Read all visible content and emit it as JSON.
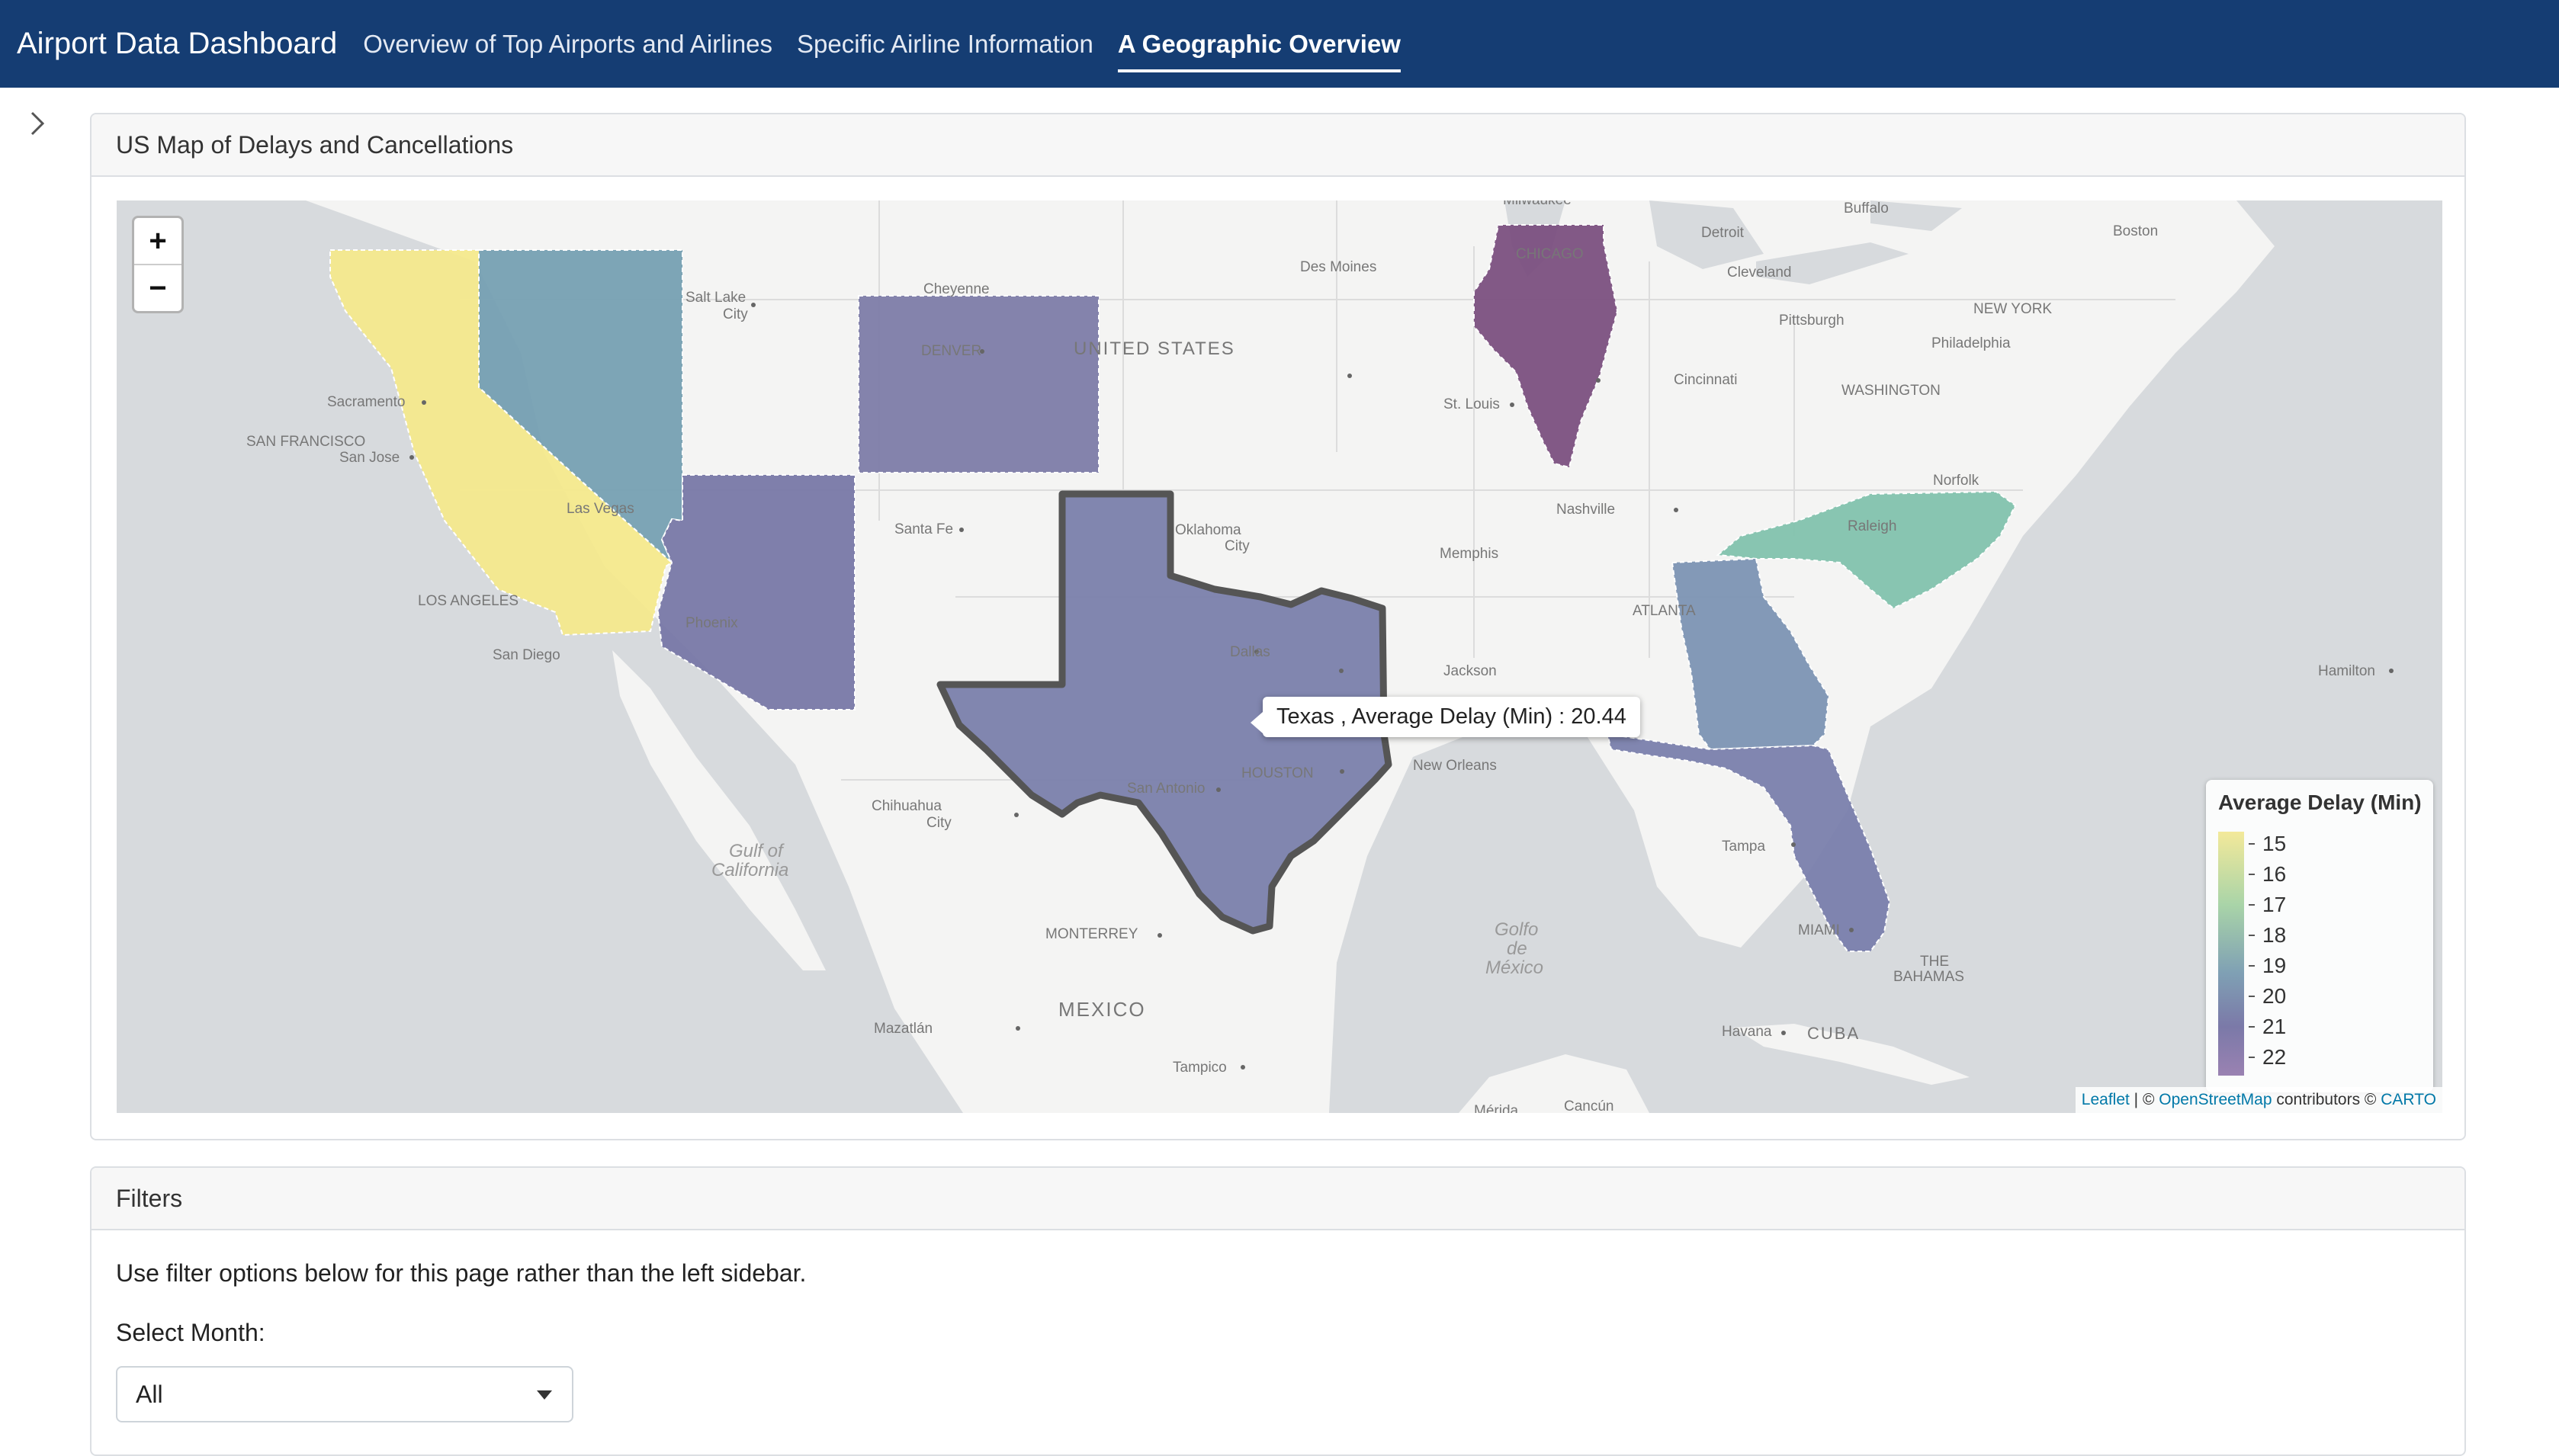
{
  "navbar": {
    "brand": "Airport Data Dashboard",
    "links": [
      {
        "label": "Overview of Top Airports and Airlines"
      },
      {
        "label": "Specific Airline Information"
      },
      {
        "label": "A Geographic Overview",
        "active": true
      }
    ]
  },
  "map_card": {
    "title": "US Map of Delays and Cancellations",
    "zoom_in": "+",
    "zoom_out": "−",
    "tooltip": "Texas , Average Delay (Min) : 20.44",
    "states": [
      {
        "name": "California",
        "color": "#f4e98c"
      },
      {
        "name": "Nevada",
        "color": "#76a0b2"
      },
      {
        "name": "Colorado",
        "color": "#7d7ca8"
      },
      {
        "name": "Arizona",
        "color": "#7878a6"
      },
      {
        "name": "Texas",
        "color": "#7a80ab"
      },
      {
        "name": "Illinois",
        "color": "#7b507f"
      },
      {
        "name": "North Carolina",
        "color": "#82c2ad"
      },
      {
        "name": "Georgia",
        "color": "#7c94b3"
      },
      {
        "name": "Florida",
        "color": "#7a80ac"
      }
    ],
    "legend": {
      "title": "Average Delay (Min)",
      "ticks": [
        "15",
        "16",
        "17",
        "18",
        "19",
        "20",
        "21",
        "22"
      ]
    },
    "map_labels": {
      "milwaukee": "Milwaukee",
      "detroit": "Detroit",
      "buffalo": "Buffalo",
      "boston": "Boston",
      "des_moines": "Des Moines",
      "chicago": "CHICAGO",
      "cleveland": "Cleveland",
      "pittsburgh": "Pittsburgh",
      "new_york": "NEW YORK",
      "philadelphia": "Philadelphia",
      "washington": "WASHINGTON",
      "salt_lake_1": "Salt Lake",
      "salt_lake_2": "City",
      "cheyenne": "Cheyenne",
      "denver": "DENVER",
      "united_states": "UNITED STATES",
      "sacramento": "Sacramento",
      "san_francisco": "SAN FRANCISCO",
      "san_jose": "San Jose",
      "st_louis": "St. Louis",
      "cincinnati": "Cincinnati",
      "nashville": "Nashville",
      "norfolk": "Norfolk",
      "raleigh": "Raleigh",
      "las_vegas": "Las Vegas",
      "santa_fe": "Santa Fe",
      "oklahoma_city_1": "Oklahoma",
      "oklahoma_city_2": "City",
      "memphis": "Memphis",
      "los_angeles": "LOS ANGELES",
      "san_diego": "San Diego",
      "phoenix": "Phoenix",
      "atlanta": "ATLANTA",
      "dallas": "Dallas",
      "jackson": "Jackson",
      "hamilton": "Hamilton",
      "new_orleans": "New Orleans",
      "houston": "HOUSTON",
      "san_antonio": "San Antonio",
      "chihuahua_1": "Chihuahua",
      "chihuahua_2": "City",
      "gulf_cal_1": "Gulf of",
      "gulf_cal_2": "California",
      "tampa": "Tampa",
      "miami": "MIAMI",
      "monterrey": "MONTERREY",
      "golfo_1": "Golfo",
      "golfo_2": "de",
      "golfo_3": "México",
      "the_bahamas_1": "THE",
      "the_bahamas_2": "BAHAMAS",
      "mexico": "MEXICO",
      "mazatlan": "Mazatlán",
      "havana": "Havana",
      "cuba": "CUBA",
      "tampico": "Tampico",
      "merida": "Mérida",
      "cancun": "Cancún"
    },
    "attribution": {
      "leaflet": "Leaflet",
      "sep": " | © ",
      "osm": "OpenStreetMap",
      "contributors": " contributors © ",
      "carto": "CARTO"
    }
  },
  "filters_card": {
    "title": "Filters",
    "description": "Use filter options below for this page rather than the left sidebar.",
    "month_label": "Select Month:",
    "month_value": "All"
  }
}
